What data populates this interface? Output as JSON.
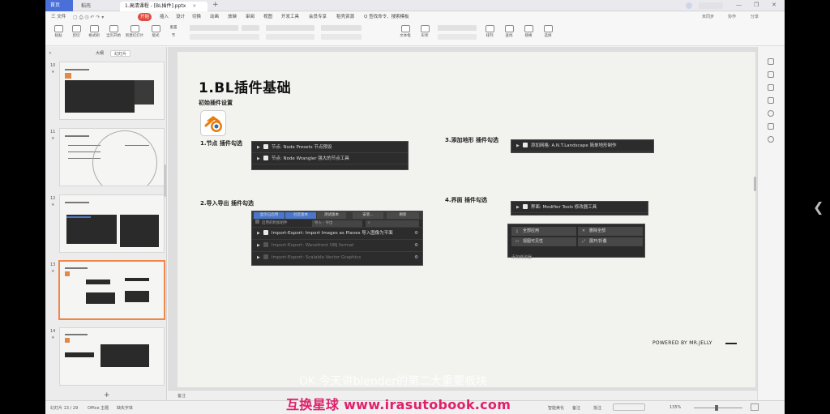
{
  "titlebar": {
    "home_tab": "首页",
    "docer_tab": "稻壳",
    "doc_tab": "1.高清课程 - [BL插件].pptx",
    "close": "×",
    "plus": "+",
    "right_badge": "",
    "minimize": "—",
    "maximize": "❐",
    "close_window": "✕"
  },
  "menubar": {
    "file": "三 文件",
    "items": [
      "开始",
      "插入",
      "设计",
      "切换",
      "动画",
      "放映",
      "审阅",
      "视图",
      "开发工具",
      "会员专享",
      "稻壳资源"
    ],
    "search": "Q 查找命令、搜索模板",
    "right": [
      "未同步",
      "协作",
      "分享"
    ]
  },
  "toolbar": {
    "tools": [
      "粘贴",
      "剪切",
      "格式刷",
      "当页开始",
      "新建幻灯片",
      "版式",
      "重置",
      "节",
      "文本框",
      "形状",
      "排列",
      "查找",
      "替换",
      "选择"
    ]
  },
  "leftpanel": {
    "tabs": [
      "大纲",
      "幻灯片"
    ],
    "slides": [
      {
        "num": "10",
        "star": "★"
      },
      {
        "num": "11",
        "star": "★"
      },
      {
        "num": "12",
        "star": "★"
      },
      {
        "num": "13",
        "star": "★"
      },
      {
        "num": "14",
        "star": "★"
      }
    ],
    "add": "+"
  },
  "slide": {
    "title": "1.BL插件基础",
    "subtitle": "初始插件设置",
    "sections": {
      "nodes": "1.节点 插件勾选",
      "io": "2.导入导出 插件勾选",
      "terrain": "3.添加地形 插件勾选",
      "interface": "4.界面 插件勾选"
    },
    "nodes_panel": [
      "节点: Node Presets 节点预设",
      "节点: Node Wrangler 强大的节点工具"
    ],
    "terrain_panel": [
      "添加网格: A.N.T.Landscape 简单地形制作"
    ],
    "interface_panel": [
      "界面: Modifier Tools 修改器工具"
    ],
    "io_panel": {
      "tabs": [
        "显示已启用",
        "社区版本",
        "测试版本",
        "安装...",
        "刷新"
      ],
      "filter": "启用的附加组件",
      "category": "导入 - 导出",
      "rows": [
        {
          "text": "Import-Export: Import Images as Planes     导入图像为平面",
          "dim": false
        },
        {
          "text": "Import-Export: Wavefront OBJ format",
          "dim": true
        },
        {
          "text": "Import-Export: Scalable Vector Graphics",
          "dim": true
        }
      ]
    },
    "modifier_buttons": {
      "apply_all": "全部应用",
      "delete_all": "删除全部",
      "viewport_vis": "视图可见性",
      "expand": "展开/折叠",
      "footer": "添加修改器"
    },
    "powered": "POWERED BY MR.JELLY",
    "caption": "OK 今天讲blender的第二大重要板块"
  },
  "notes": "备注",
  "statusbar": {
    "slide_count": "幻灯片 13 / 29",
    "theme": "Office 主题",
    "missing_font": "缺失字体",
    "smart": "智能美化",
    "notes": "备注",
    "comment": "批注",
    "zoom": "135%"
  },
  "watermark": "互换星球 www.irasutobook.com"
}
